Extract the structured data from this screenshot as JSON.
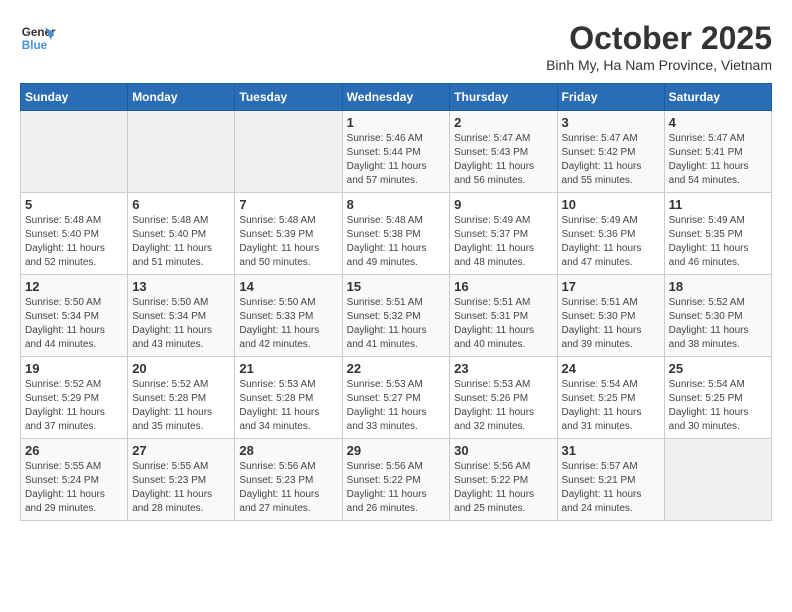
{
  "logo": {
    "line1": "General",
    "line2": "Blue"
  },
  "title": "October 2025",
  "subtitle": "Binh My, Ha Nam Province, Vietnam",
  "headers": [
    "Sunday",
    "Monday",
    "Tuesday",
    "Wednesday",
    "Thursday",
    "Friday",
    "Saturday"
  ],
  "weeks": [
    [
      {
        "day": "",
        "info": ""
      },
      {
        "day": "",
        "info": ""
      },
      {
        "day": "",
        "info": ""
      },
      {
        "day": "1",
        "info": "Sunrise: 5:46 AM\nSunset: 5:44 PM\nDaylight: 11 hours\nand 57 minutes."
      },
      {
        "day": "2",
        "info": "Sunrise: 5:47 AM\nSunset: 5:43 PM\nDaylight: 11 hours\nand 56 minutes."
      },
      {
        "day": "3",
        "info": "Sunrise: 5:47 AM\nSunset: 5:42 PM\nDaylight: 11 hours\nand 55 minutes."
      },
      {
        "day": "4",
        "info": "Sunrise: 5:47 AM\nSunset: 5:41 PM\nDaylight: 11 hours\nand 54 minutes."
      }
    ],
    [
      {
        "day": "5",
        "info": "Sunrise: 5:48 AM\nSunset: 5:40 PM\nDaylight: 11 hours\nand 52 minutes."
      },
      {
        "day": "6",
        "info": "Sunrise: 5:48 AM\nSunset: 5:40 PM\nDaylight: 11 hours\nand 51 minutes."
      },
      {
        "day": "7",
        "info": "Sunrise: 5:48 AM\nSunset: 5:39 PM\nDaylight: 11 hours\nand 50 minutes."
      },
      {
        "day": "8",
        "info": "Sunrise: 5:48 AM\nSunset: 5:38 PM\nDaylight: 11 hours\nand 49 minutes."
      },
      {
        "day": "9",
        "info": "Sunrise: 5:49 AM\nSunset: 5:37 PM\nDaylight: 11 hours\nand 48 minutes."
      },
      {
        "day": "10",
        "info": "Sunrise: 5:49 AM\nSunset: 5:36 PM\nDaylight: 11 hours\nand 47 minutes."
      },
      {
        "day": "11",
        "info": "Sunrise: 5:49 AM\nSunset: 5:35 PM\nDaylight: 11 hours\nand 46 minutes."
      }
    ],
    [
      {
        "day": "12",
        "info": "Sunrise: 5:50 AM\nSunset: 5:34 PM\nDaylight: 11 hours\nand 44 minutes."
      },
      {
        "day": "13",
        "info": "Sunrise: 5:50 AM\nSunset: 5:34 PM\nDaylight: 11 hours\nand 43 minutes."
      },
      {
        "day": "14",
        "info": "Sunrise: 5:50 AM\nSunset: 5:33 PM\nDaylight: 11 hours\nand 42 minutes."
      },
      {
        "day": "15",
        "info": "Sunrise: 5:51 AM\nSunset: 5:32 PM\nDaylight: 11 hours\nand 41 minutes."
      },
      {
        "day": "16",
        "info": "Sunrise: 5:51 AM\nSunset: 5:31 PM\nDaylight: 11 hours\nand 40 minutes."
      },
      {
        "day": "17",
        "info": "Sunrise: 5:51 AM\nSunset: 5:30 PM\nDaylight: 11 hours\nand 39 minutes."
      },
      {
        "day": "18",
        "info": "Sunrise: 5:52 AM\nSunset: 5:30 PM\nDaylight: 11 hours\nand 38 minutes."
      }
    ],
    [
      {
        "day": "19",
        "info": "Sunrise: 5:52 AM\nSunset: 5:29 PM\nDaylight: 11 hours\nand 37 minutes."
      },
      {
        "day": "20",
        "info": "Sunrise: 5:52 AM\nSunset: 5:28 PM\nDaylight: 11 hours\nand 35 minutes."
      },
      {
        "day": "21",
        "info": "Sunrise: 5:53 AM\nSunset: 5:28 PM\nDaylight: 11 hours\nand 34 minutes."
      },
      {
        "day": "22",
        "info": "Sunrise: 5:53 AM\nSunset: 5:27 PM\nDaylight: 11 hours\nand 33 minutes."
      },
      {
        "day": "23",
        "info": "Sunrise: 5:53 AM\nSunset: 5:26 PM\nDaylight: 11 hours\nand 32 minutes."
      },
      {
        "day": "24",
        "info": "Sunrise: 5:54 AM\nSunset: 5:25 PM\nDaylight: 11 hours\nand 31 minutes."
      },
      {
        "day": "25",
        "info": "Sunrise: 5:54 AM\nSunset: 5:25 PM\nDaylight: 11 hours\nand 30 minutes."
      }
    ],
    [
      {
        "day": "26",
        "info": "Sunrise: 5:55 AM\nSunset: 5:24 PM\nDaylight: 11 hours\nand 29 minutes."
      },
      {
        "day": "27",
        "info": "Sunrise: 5:55 AM\nSunset: 5:23 PM\nDaylight: 11 hours\nand 28 minutes."
      },
      {
        "day": "28",
        "info": "Sunrise: 5:56 AM\nSunset: 5:23 PM\nDaylight: 11 hours\nand 27 minutes."
      },
      {
        "day": "29",
        "info": "Sunrise: 5:56 AM\nSunset: 5:22 PM\nDaylight: 11 hours\nand 26 minutes."
      },
      {
        "day": "30",
        "info": "Sunrise: 5:56 AM\nSunset: 5:22 PM\nDaylight: 11 hours\nand 25 minutes."
      },
      {
        "day": "31",
        "info": "Sunrise: 5:57 AM\nSunset: 5:21 PM\nDaylight: 11 hours\nand 24 minutes."
      },
      {
        "day": "",
        "info": ""
      }
    ]
  ]
}
